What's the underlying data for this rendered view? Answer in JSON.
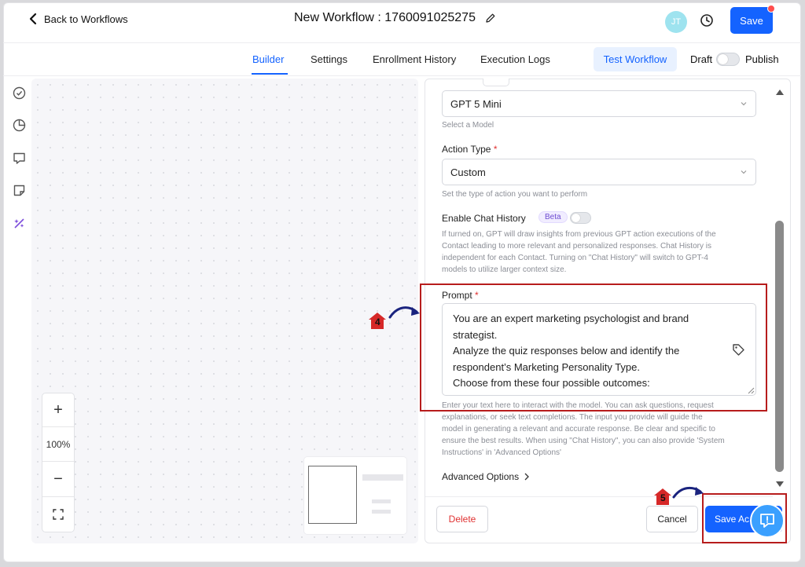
{
  "header": {
    "back_label": "Back to Workflows",
    "title": "New Workflow : 1760091025275",
    "avatar_initials": "JT",
    "save_label": "Save"
  },
  "tabs": {
    "items": [
      {
        "label": "Builder",
        "active": true
      },
      {
        "label": "Settings",
        "active": false
      },
      {
        "label": "Enrollment History",
        "active": false
      },
      {
        "label": "Execution Logs",
        "active": false
      }
    ],
    "test_workflow_label": "Test Workflow",
    "draft_label": "Draft",
    "publish_label": "Publish"
  },
  "left_nav": {
    "icons": [
      "check-circle-icon",
      "pie-chart-icon",
      "comment-icon",
      "note-icon",
      "ai-sparkle-icon"
    ]
  },
  "zoom": {
    "zoom_in": "+",
    "level": "100%",
    "zoom_out": "−"
  },
  "panel": {
    "model": {
      "value": "GPT 5 Mini",
      "helper": "Select a Model"
    },
    "action_type": {
      "label": "Action Type",
      "value": "Custom",
      "helper": "Set the type of action you want to perform"
    },
    "chat_history": {
      "label": "Enable Chat History",
      "badge": "Beta",
      "helper": [
        "If turned on, GPT will draw insights from previous GPT action executions of the",
        "Contact leading to more relevant and personalized responses. Chat History is",
        "independent for each Contact. Turning on \"Chat History\" will switch to GPT-4",
        "models to utilize larger context size."
      ]
    },
    "prompt": {
      "label": "Prompt",
      "lines": [
        "You are an expert marketing psychologist and brand",
        "strategist.",
        "Analyze the quiz responses below and identify the",
        "respondent’s Marketing Personality Type.",
        "Choose from these four possible outcomes:"
      ],
      "helper": [
        "Enter your text here to interact with the model. You can ask questions, request",
        "explanations, or seek text completions. The input you provide will guide the",
        "model in generating a relevant and accurate response. Be clear and specific to",
        "ensure the best results. When using \"Chat History\", you can also provide 'System",
        "Instructions' in 'Advanced Options'"
      ]
    },
    "advanced_options_label": "Advanced Options",
    "delete_label": "Delete",
    "cancel_label": "Cancel",
    "save_action_label": "Save Ac"
  },
  "annotations": {
    "step4": "4",
    "step5": "5",
    "highlight_color": "#b71c1c"
  },
  "colors": {
    "primary": "#1463ff",
    "danger": "#e03131"
  }
}
